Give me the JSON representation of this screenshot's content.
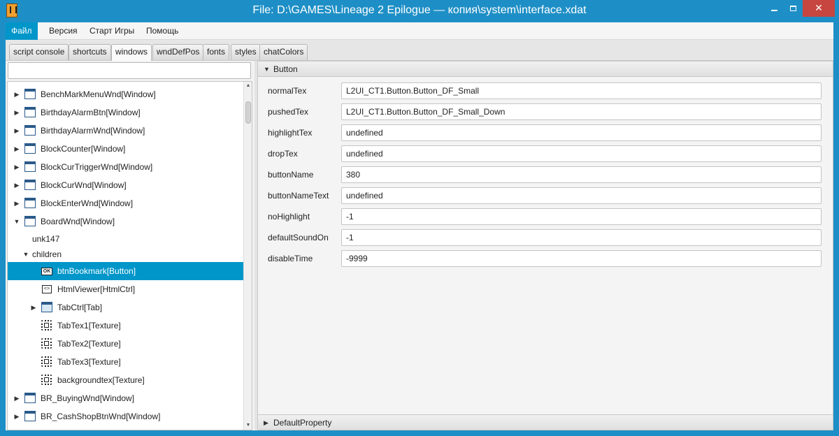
{
  "window": {
    "title": "File: D:\\GAMES\\Lineage 2 Epilogue — копия\\system\\interface.xdat",
    "minimize_glyph": "",
    "close_glyph": "✕"
  },
  "menu": [
    "Файл",
    "Версия",
    "Старт Игры",
    "Помощь"
  ],
  "tabs": [
    "script console",
    "shortcuts",
    "windows",
    "wndDefPos",
    "fonts",
    "styles",
    "chatColors"
  ],
  "active_tab": "windows",
  "search": {
    "value": "",
    "placeholder": ""
  },
  "tree": [
    {
      "label": "BenchMarkMenuWnd[Window]",
      "icon": "window-icon",
      "arrow": "▶"
    },
    {
      "label": "BirthdayAlarmBtn[Window]",
      "icon": "window-icon",
      "arrow": "▶"
    },
    {
      "label": "BirthdayAlarmWnd[Window]",
      "icon": "window-icon",
      "arrow": "▶"
    },
    {
      "label": "BlockCounter[Window]",
      "icon": "window-icon",
      "arrow": "▶"
    },
    {
      "label": "BlockCurTriggerWnd[Window]",
      "icon": "window-icon",
      "arrow": "▶"
    },
    {
      "label": "BlockCurWnd[Window]",
      "icon": "window-icon",
      "arrow": "▶"
    },
    {
      "label": "BlockEnterWnd[Window]",
      "icon": "window-icon",
      "arrow": "▶"
    },
    {
      "label": "BoardWnd[Window]",
      "icon": "window-icon",
      "arrow": "▼"
    },
    {
      "label": "unk147",
      "icon": "",
      "arrow": ""
    },
    {
      "label": "children",
      "icon": "",
      "arrow": "▼"
    },
    {
      "label": "btnBookmark[Button]",
      "icon": "button-icon",
      "arrow": "",
      "icon_text": "OK"
    },
    {
      "label": "HtmlViewer[HtmlCtrl]",
      "icon": "html-icon",
      "arrow": "",
      "icon_text": "<>"
    },
    {
      "label": "TabCtrl[Tab]",
      "icon": "tab-icon",
      "arrow": "▶"
    },
    {
      "label": "TabTex1[Texture]",
      "icon": "texture-icon",
      "arrow": ""
    },
    {
      "label": "TabTex2[Texture]",
      "icon": "texture-icon",
      "arrow": ""
    },
    {
      "label": "TabTex3[Texture]",
      "icon": "texture-icon",
      "arrow": ""
    },
    {
      "label": "backgroundtex[Texture]",
      "icon": "texture-icon",
      "arrow": ""
    },
    {
      "label": "BR_BuyingWnd[Window]",
      "icon": "window-icon",
      "arrow": "▶"
    },
    {
      "label": "BR_CashShopBtnWnd[Window]",
      "icon": "window-icon",
      "arrow": "▶"
    }
  ],
  "selected_tree_item": "btnBookmark[Button]",
  "scroll": {
    "up": "▲",
    "down": "▼"
  },
  "properties": {
    "section_title": "Button",
    "section_arrow": "▼",
    "rows": [
      {
        "label": "normalTex",
        "value": "L2UI_CT1.Button.Button_DF_Small"
      },
      {
        "label": "pushedTex",
        "value": "L2UI_CT1.Button.Button_DF_Small_Down"
      },
      {
        "label": "highlightTex",
        "value": "undefined"
      },
      {
        "label": "dropTex",
        "value": "undefined"
      },
      {
        "label": "buttonName",
        "value": "380"
      },
      {
        "label": "buttonNameText",
        "value": "undefined"
      },
      {
        "label": "noHighlight",
        "value": "-1"
      },
      {
        "label": "defaultSoundOn",
        "value": "-1"
      },
      {
        "label": "disableTime",
        "value": "-9999"
      }
    ],
    "collapsed_section_title": "DefaultProperty",
    "collapsed_section_arrow": "▶"
  },
  "colors": {
    "titlebar": "#1e8fc6",
    "selection": "#0096c9",
    "close_button": "#c7463f"
  }
}
